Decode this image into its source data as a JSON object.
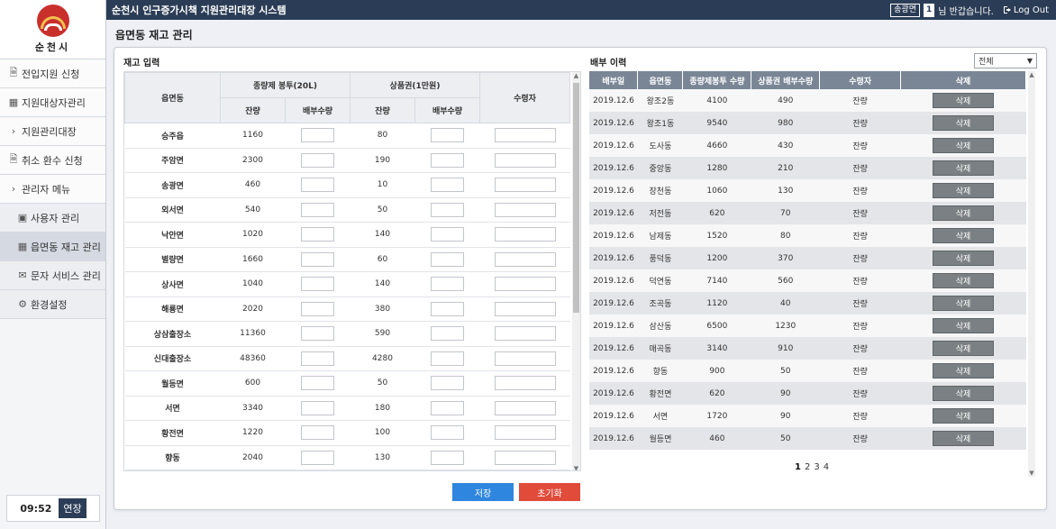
{
  "app": {
    "logo_text": "순천시",
    "title": "순천시 인구증가시책 지원관리대장 시스템",
    "user_name": "송광면",
    "notice_count": "1",
    "greeting": "님 반갑습니다.",
    "logout": "Log Out"
  },
  "sidebar": {
    "items": [
      {
        "label": "전입지원 신청",
        "icon": "doc-icon"
      },
      {
        "label": "지원대상자관리",
        "icon": "table-icon"
      },
      {
        "label": "지원관리대장",
        "icon": "chevron-right-icon"
      },
      {
        "label": "취소 환수 신청",
        "icon": "doc-icon"
      },
      {
        "label": "관리자 메뉴",
        "icon": "chevron-right-icon"
      },
      {
        "label": "사용자 관리",
        "icon": "user-card-icon"
      },
      {
        "label": "읍면동 재고 관리",
        "icon": "table-icon"
      },
      {
        "label": "문자 서비스 관리",
        "icon": "mail-icon"
      },
      {
        "label": "환경설정",
        "icon": "gear-icon"
      }
    ],
    "timer": "09:52",
    "extend": "연장"
  },
  "page": {
    "title": "읍면동 재고 관리"
  },
  "stock": {
    "section_title": "재고 입력",
    "headers": {
      "town": "읍면동",
      "bags": "종량제 봉투(20L)",
      "vouchers": "상품권(1만원)",
      "remaining": "잔량",
      "distribute": "배부수량",
      "receiver": "수령자"
    },
    "rows": [
      {
        "town": "승주읍",
        "bags": "1160",
        "vouchers": "80"
      },
      {
        "town": "주암면",
        "bags": "2300",
        "vouchers": "190"
      },
      {
        "town": "송광면",
        "bags": "460",
        "vouchers": "10"
      },
      {
        "town": "외서면",
        "bags": "540",
        "vouchers": "50"
      },
      {
        "town": "낙안면",
        "bags": "1020",
        "vouchers": "140"
      },
      {
        "town": "별량면",
        "bags": "1660",
        "vouchers": "60"
      },
      {
        "town": "상사면",
        "bags": "1040",
        "vouchers": "140"
      },
      {
        "town": "해룡면",
        "bags": "2020",
        "vouchers": "380"
      },
      {
        "town": "상삼출장소",
        "bags": "11360",
        "vouchers": "590"
      },
      {
        "town": "신대출장소",
        "bags": "48360",
        "vouchers": "4280"
      },
      {
        "town": "월등면",
        "bags": "600",
        "vouchers": "50"
      },
      {
        "town": "서면",
        "bags": "3340",
        "vouchers": "180"
      },
      {
        "town": "황전면",
        "bags": "1220",
        "vouchers": "100"
      },
      {
        "town": "향동",
        "bags": "2040",
        "vouchers": "130"
      },
      {
        "town": "",
        "bags": "",
        "vouchers": ""
      }
    ],
    "save": "저장",
    "reset": "초기화"
  },
  "history": {
    "section_title": "배부 이력",
    "filter": "전체",
    "headers": [
      "배부일",
      "읍면동",
      "종량제봉투 수량",
      "상품권 배부수량",
      "수령자",
      "삭제"
    ],
    "rows": [
      {
        "date": "2019.12.6",
        "town": "왕조2동",
        "bags": "4100",
        "vouchers": "490",
        "receiver": "잔량"
      },
      {
        "date": "2019.12.6",
        "town": "왕조1동",
        "bags": "9540",
        "vouchers": "980",
        "receiver": "잔량"
      },
      {
        "date": "2019.12.6",
        "town": "도사동",
        "bags": "4660",
        "vouchers": "430",
        "receiver": "잔량"
      },
      {
        "date": "2019.12.6",
        "town": "중앙동",
        "bags": "1280",
        "vouchers": "210",
        "receiver": "잔량"
      },
      {
        "date": "2019.12.6",
        "town": "장천동",
        "bags": "1060",
        "vouchers": "130",
        "receiver": "잔량"
      },
      {
        "date": "2019.12.6",
        "town": "저전동",
        "bags": "620",
        "vouchers": "70",
        "receiver": "잔량"
      },
      {
        "date": "2019.12.6",
        "town": "남제동",
        "bags": "1520",
        "vouchers": "80",
        "receiver": "잔량"
      },
      {
        "date": "2019.12.6",
        "town": "풍덕동",
        "bags": "1200",
        "vouchers": "370",
        "receiver": "잔량"
      },
      {
        "date": "2019.12.6",
        "town": "덕연동",
        "bags": "7140",
        "vouchers": "560",
        "receiver": "잔량"
      },
      {
        "date": "2019.12.6",
        "town": "조곡동",
        "bags": "1120",
        "vouchers": "40",
        "receiver": "잔량"
      },
      {
        "date": "2019.12.6",
        "town": "삼산동",
        "bags": "6500",
        "vouchers": "1230",
        "receiver": "잔량"
      },
      {
        "date": "2019.12.6",
        "town": "매곡동",
        "bags": "3140",
        "vouchers": "910",
        "receiver": "잔량"
      },
      {
        "date": "2019.12.6",
        "town": "향동",
        "bags": "900",
        "vouchers": "50",
        "receiver": "잔량"
      },
      {
        "date": "2019.12.6",
        "town": "황전면",
        "bags": "620",
        "vouchers": "90",
        "receiver": "잔량"
      },
      {
        "date": "2019.12.6",
        "town": "서면",
        "bags": "1720",
        "vouchers": "90",
        "receiver": "잔량"
      },
      {
        "date": "2019.12.6",
        "town": "월등면",
        "bags": "460",
        "vouchers": "50",
        "receiver": "잔량"
      }
    ],
    "delete_label": "삭제",
    "pages": [
      "1",
      "2",
      "3",
      "4"
    ],
    "current_page": "1"
  }
}
